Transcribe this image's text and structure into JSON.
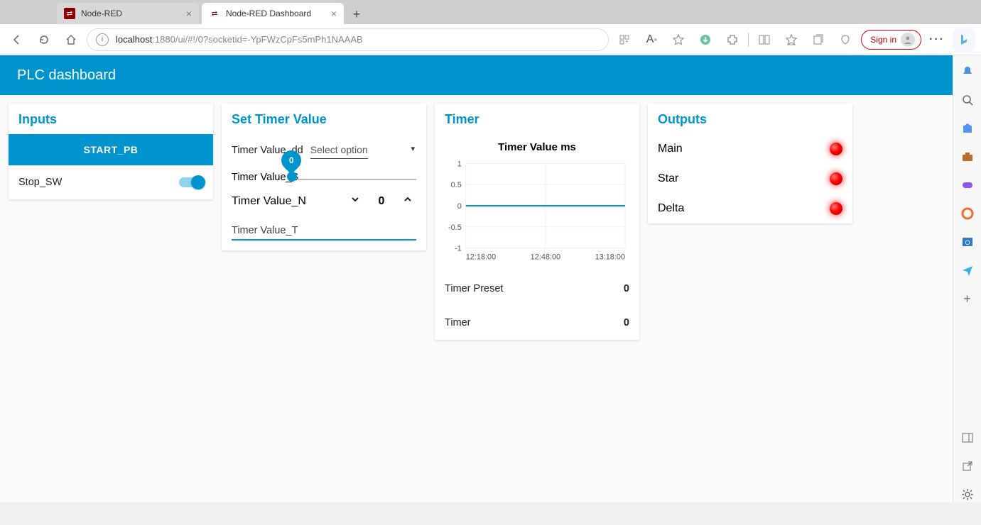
{
  "browser": {
    "tabs": [
      {
        "title": "Node-RED",
        "active": false
      },
      {
        "title": "Node-RED Dashboard",
        "active": true
      }
    ],
    "url_host": "localhost",
    "url_port_path": ":1880/ui/#!/0?socketid=-YpFWzCpFs5mPh1NAAAB",
    "signin_label": "Sign in"
  },
  "header": {
    "title": "PLC dashboard"
  },
  "inputs": {
    "title": "Inputs",
    "button_label": "START_PB",
    "switch_label": "Stop_SW",
    "switch_on": true
  },
  "set_timer": {
    "title": "Set Timer Value",
    "dd_label": "Timer Value_dd",
    "dd_placeholder": "Select option",
    "slider_label": "Timer Value_S",
    "slider_value": "0",
    "num_label": "Timer Value_N",
    "num_value": "0",
    "text_label": "Timer Value_T"
  },
  "timer": {
    "title": "Timer",
    "preset_label": "Timer Preset",
    "preset_value": "0",
    "timer_label": "Timer",
    "timer_value": "0"
  },
  "outputs": {
    "title": "Outputs",
    "items": [
      {
        "label": "Main"
      },
      {
        "label": "Star"
      },
      {
        "label": "Delta"
      }
    ]
  },
  "chart_data": {
    "type": "line",
    "title": "Timer Value ms",
    "xlabel": "",
    "ylabel": "",
    "ylim": [
      -1,
      1
    ],
    "yticks": [
      -1,
      -0.5,
      0,
      0.5,
      1
    ],
    "xticks": [
      "12:18:00",
      "12:48:00",
      "13:18:00"
    ],
    "series": [
      {
        "name": "Timer Value",
        "x": [
          "12:18:00",
          "13:18:00"
        ],
        "y": [
          0,
          0
        ]
      }
    ]
  }
}
